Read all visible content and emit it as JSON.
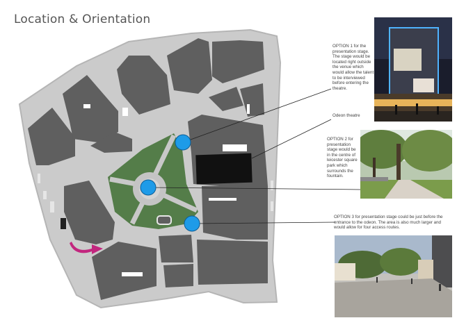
{
  "title": "Location & Orientation",
  "notes": {
    "option1": "OPTION 1 for the presentation stage. The stage would be located right outside the venue which would allow the talent to be interviewed before entering the theatre.",
    "odeon": "Odeon theatre",
    "option2": "OPTION 2 for presentation stage would be in the centre of leicester square park which surrounds the fountain.",
    "option3": "OPTION 3 for  presentation stage could be just before the entrance to the odeon. The area is also much larger and would allow for four access routes."
  },
  "colors": {
    "building": "#5d5d5d",
    "street": "#c9c9c9",
    "park": "#4f7a45",
    "option_marker": "#1e9be8",
    "arrow": "#c2267e",
    "odeon": "#111111"
  },
  "icons": [
    "entry-arrow-icon",
    "option-marker-icon"
  ]
}
